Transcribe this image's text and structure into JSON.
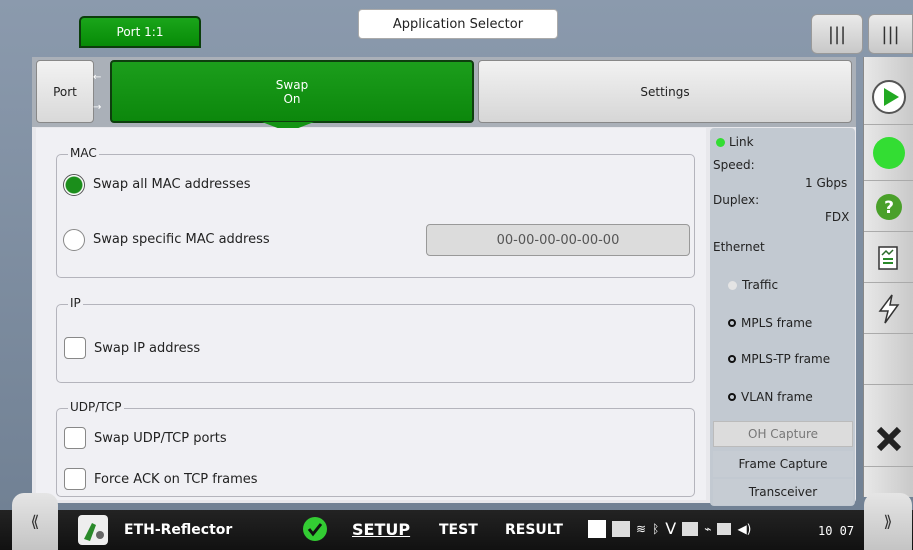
{
  "header": {
    "port_tab": "Port 1:1",
    "app_selector": "Application Selector"
  },
  "tabs": {
    "port": "Port",
    "swap_line1": "Swap",
    "swap_line2": "On",
    "settings": "Settings"
  },
  "mac": {
    "title": "MAC",
    "swap_all": "Swap all MAC addresses",
    "swap_specific": "Swap specific MAC address",
    "address_value": "00-00-00-00-00-00",
    "selected": "swap_all"
  },
  "ip": {
    "title": "IP",
    "swap_ip": "Swap IP address"
  },
  "udptcp": {
    "title": "UDP/TCP",
    "swap_ports": "Swap UDP/TCP ports",
    "force_ack": "Force ACK on TCP frames"
  },
  "status": {
    "link": "Link",
    "speed_label": "Speed:",
    "speed_value": "1 Gbps",
    "duplex_label": "Duplex:",
    "duplex_value": "FDX",
    "ethernet": "Ethernet",
    "traffic": "Traffic",
    "mpls": "MPLS frame",
    "mpls_tp": "MPLS-TP frame",
    "vlan": "VLAN frame",
    "oh_capture": "OH Capture",
    "frame_capture": "Frame Capture",
    "transceiver": "Transceiver"
  },
  "bottom": {
    "app_name": "ETH-Reflector",
    "setup": "SETUP",
    "test": "TEST",
    "result": "RESULT",
    "clock": "10 07"
  },
  "colors": {
    "accent_green": "#139413",
    "status_green": "#33dd33"
  },
  "icons": [
    "play-icon",
    "status-led-icon",
    "help-icon",
    "report-icon",
    "lightning-icon",
    "close-icon",
    "menu-icon",
    "chevron-left-icon",
    "chevron-right-icon",
    "app-icon",
    "check-icon"
  ]
}
